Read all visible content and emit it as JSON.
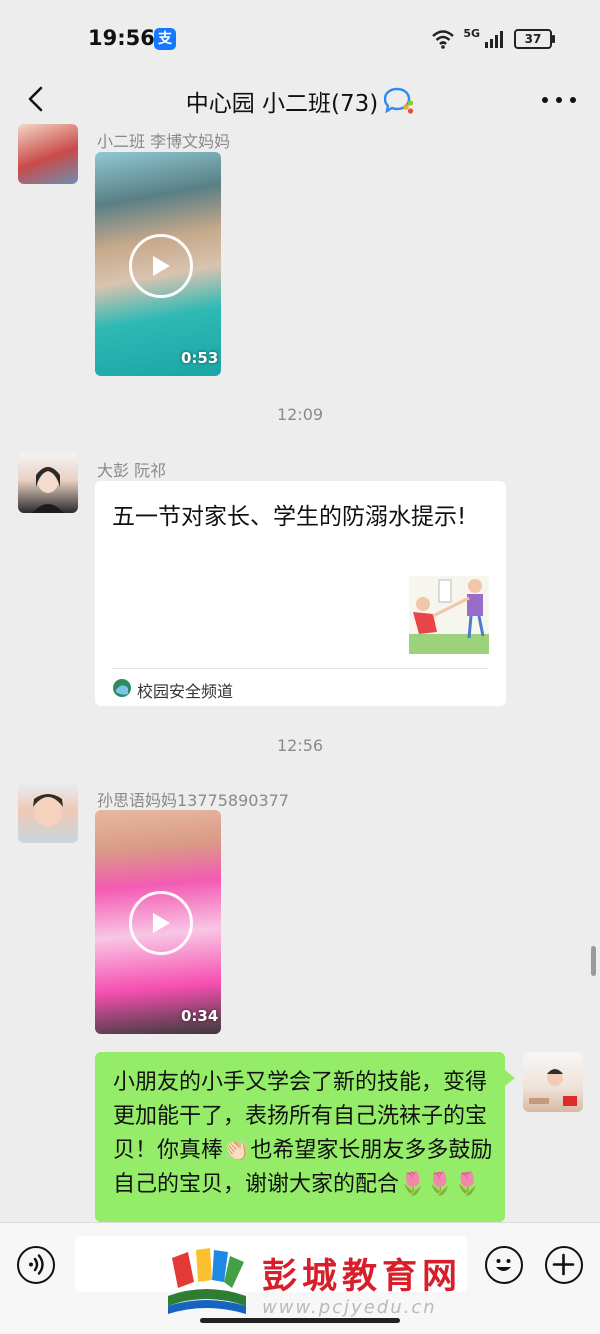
{
  "status_bar": {
    "time": "19:56",
    "alipay_badge": "支",
    "network": "5G",
    "battery": "37"
  },
  "header": {
    "title": "中心园 小二班(73)"
  },
  "messages": [
    {
      "sender": "小二班 李博文妈妈",
      "type": "video",
      "duration": "0:53"
    },
    {
      "timestamp": "12:09"
    },
    {
      "sender": "大彭 阮祁",
      "type": "link_card",
      "title": "五一节对家长、学生的防溺水提示!",
      "source": "校园安全频道"
    },
    {
      "timestamp": "12:56"
    },
    {
      "sender": "孙思语妈妈13775890377",
      "type": "video",
      "duration": "0:34"
    },
    {
      "sender": "me",
      "type": "text",
      "text": "小朋友的小手又学会了新的技能，变得更加能干了，表扬所有自己洗袜子的宝贝！你真棒👏🏻也希望家长朋友多多鼓励自己的宝贝，谢谢大家的配合🌷🌷🌷"
    }
  ],
  "watermark": {
    "name": "彭城教育网",
    "url": "www.pcjyedu.cn"
  },
  "colors": {
    "background": "#ededed",
    "my_bubble": "#95ec69",
    "watermark_red": "#d81e2a"
  }
}
